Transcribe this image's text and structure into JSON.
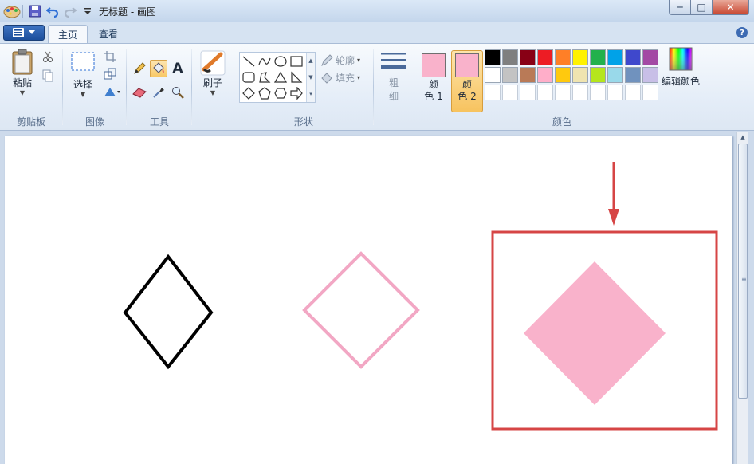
{
  "window": {
    "title": "无标题 - 画图",
    "minimize_glyph": "─",
    "maximize_glyph": "□",
    "close_glyph": "✕"
  },
  "tabs": [
    {
      "label": "主页"
    },
    {
      "label": "查看"
    }
  ],
  "help_glyph": "?",
  "ribbon": {
    "clipboard": {
      "paste_label": "粘贴",
      "group_label": "剪贴板"
    },
    "image": {
      "select_label": "选择",
      "group_label": "图像"
    },
    "tools": {
      "group_label": "工具",
      "text_glyph": "A"
    },
    "brushes": {
      "label": "刷子"
    },
    "shapes": {
      "outline_label": "轮廓",
      "fill_label": "填充",
      "group_label": "形状"
    },
    "size": {
      "label_line1": "粗",
      "label_line2": "细"
    },
    "colors": {
      "color1_line1": "颜",
      "color1_line2": "色 1",
      "color2_line1": "颜",
      "color2_line2": "色 2",
      "color1_value": "#f9b2cb",
      "color2_value": "#f9b2cb",
      "edit_label": "编辑颜色",
      "group_label": "颜色",
      "palette_row1": [
        "#000000",
        "#7f7f7f",
        "#880015",
        "#ed1c24",
        "#ff7f27",
        "#fff200",
        "#22b14c",
        "#00a2e8",
        "#3f48cc",
        "#a349a4"
      ],
      "palette_row2": [
        "#ffffff",
        "#c3c3c3",
        "#b97a57",
        "#ffaec9",
        "#ffc90e",
        "#efe4b0",
        "#b5e61d",
        "#99d9ea",
        "#7092be",
        "#c8bfe7"
      ]
    }
  },
  "canvas": {
    "annotation_color": "#d64545",
    "diamond_outline_black": "#000000",
    "diamond_outline_pink": "#f2a7c4",
    "diamond_fill_pink": "#f9b2cb"
  }
}
